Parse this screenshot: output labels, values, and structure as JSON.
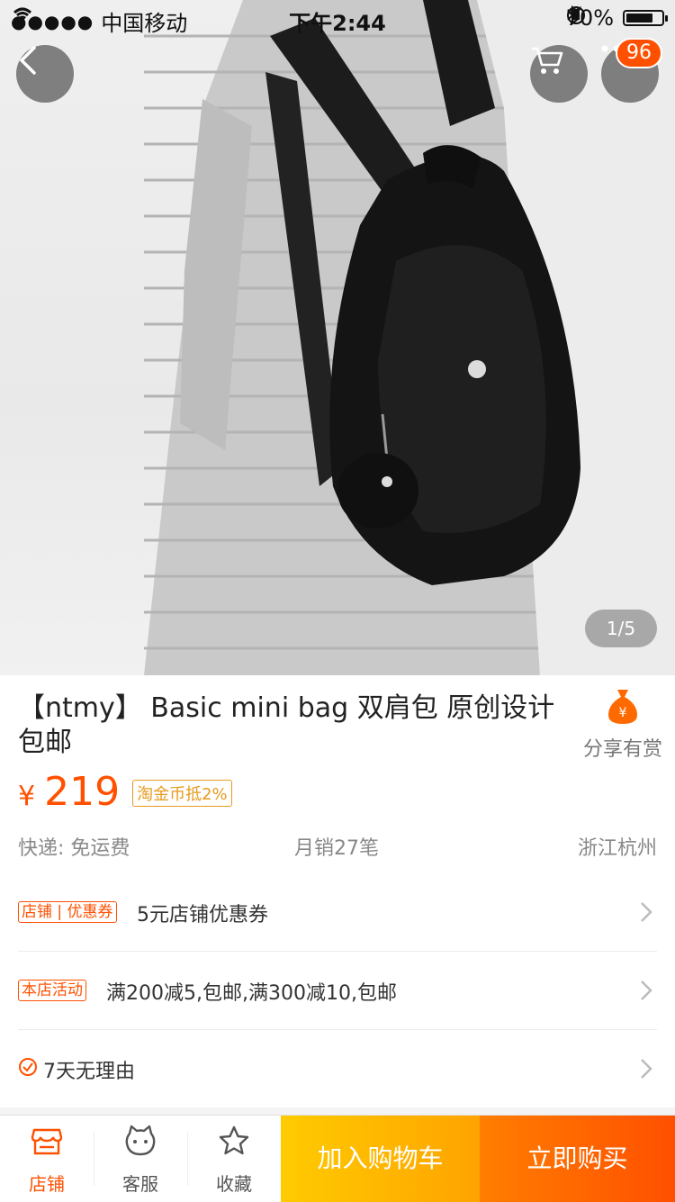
{
  "status_bar": {
    "signal": "●●●●●",
    "carrier": "中国移动",
    "time": "下午2:44",
    "battery_pct": "70%"
  },
  "nav": {
    "cart_badge": "96"
  },
  "gallery": {
    "counter": "1/5"
  },
  "product": {
    "title": "【ntmy】 Basic mini bag 双肩包 原创设计包邮",
    "share_label": "分享有赏",
    "price_symbol": "¥",
    "price": "219",
    "coin_tag": "淘金币抵2%",
    "shipping": "快递: 免运费",
    "monthly_sales": "月销27笔",
    "location": "浙江杭州"
  },
  "promos": [
    {
      "tag": "店铺 | 优惠券",
      "text": "5元店铺优惠券"
    },
    {
      "tag": "本店活动",
      "text": "满200减5,包邮,满300减10,包邮"
    },
    {
      "tag": "",
      "text": "7天无理由"
    }
  ],
  "bottom_bar": {
    "shop_label": "店铺",
    "service_label": "客服",
    "fav_label": "收藏",
    "add_cart_label": "加入购物车",
    "buy_now_label": "立即购买"
  },
  "colors": {
    "accent": "#ff5000",
    "add_cart_bg": "#ffb000",
    "buy_now_bg": "#ff6a00"
  }
}
